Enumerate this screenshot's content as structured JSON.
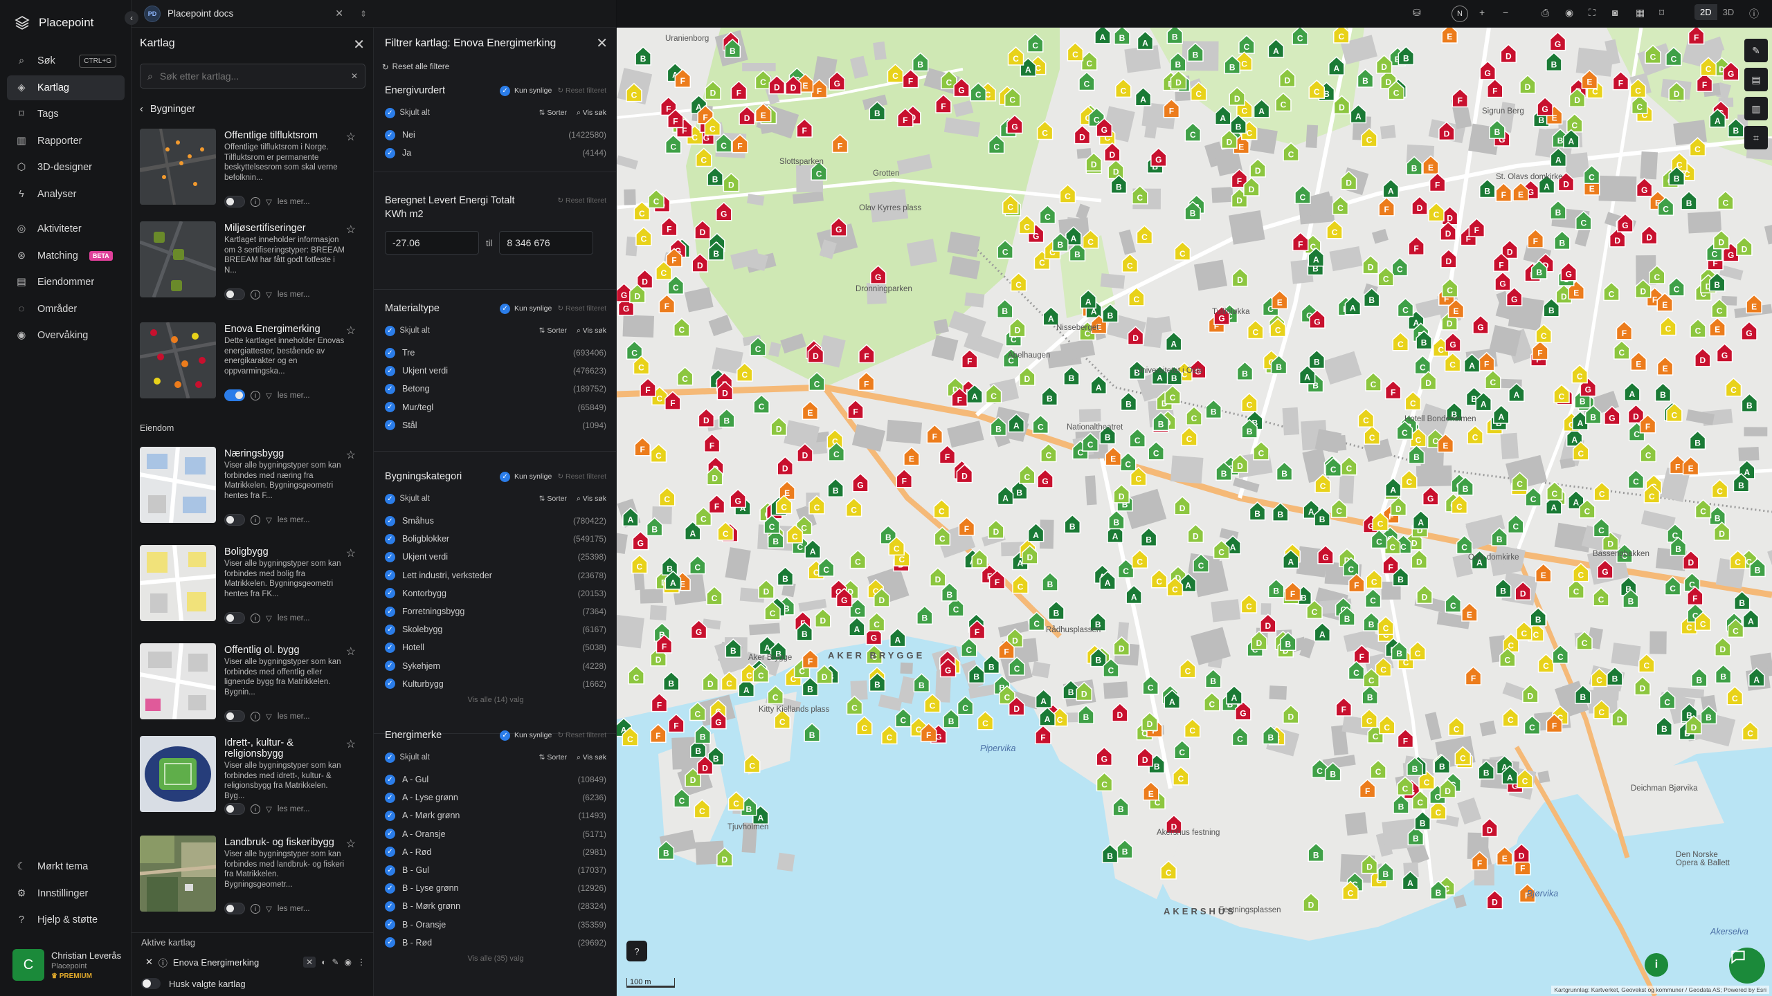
{
  "app": {
    "name": "Placepoint"
  },
  "nav": {
    "items": [
      {
        "label": "Søk",
        "icon": "search-icon",
        "shortcut": "CTRL+G"
      },
      {
        "label": "Kartlag",
        "icon": "layers-icon"
      },
      {
        "label": "Tags",
        "icon": "bookmark-icon"
      },
      {
        "label": "Rapporter",
        "icon": "chart-icon"
      },
      {
        "label": "3D-designer",
        "icon": "cube-icon"
      },
      {
        "label": "Analyser",
        "icon": "lightning-icon"
      },
      {
        "label": "Aktiviteter",
        "icon": "activity-icon"
      },
      {
        "label": "Matching",
        "icon": "matching-icon",
        "badge": "BETA"
      },
      {
        "label": "Eiendommer",
        "icon": "building-icon"
      },
      {
        "label": "Områder",
        "icon": "area-icon"
      },
      {
        "label": "Overvåking",
        "icon": "monitor-icon"
      }
    ],
    "bottom": [
      {
        "label": "Mørkt tema",
        "icon": "moon-icon"
      },
      {
        "label": "Innstillinger",
        "icon": "gear-icon"
      },
      {
        "label": "Hjelp & støtte",
        "icon": "help-icon"
      }
    ],
    "user": {
      "initial": "C",
      "name": "Christian Leverås",
      "org": "Placepoint",
      "plan": "PREMIUM"
    }
  },
  "tab": {
    "badge": "PD",
    "title": "Placepoint docs"
  },
  "layers": {
    "title": "Kartlag",
    "search_placeholder": "Søk etter kartlag...",
    "breadcrumb": "Bygninger",
    "more_label": "les mer...",
    "cards1": [
      {
        "title": "Offentlige tilfluktsrom",
        "desc": "Offentlige tilfluktsrom i Norge. Tilfluktsrom er permanente beskyttelsesrom som skal verne befolknin...",
        "on": false,
        "thumb": "dark-dots"
      },
      {
        "title": "Miljøsertifiseringer",
        "desc": "Kartlaget inneholder informasjon om 3 sertifiseringstyper: BREEAM BREEAM har fått godt fotfeste i N...",
        "on": false,
        "thumb": "dark-leaf"
      },
      {
        "title": "Enova Energimerking",
        "desc": "Dette kartlaget inneholder Enovas energiattester, bestående av energikarakter og en oppvarmingska...",
        "on": true,
        "thumb": "dark-energy"
      }
    ],
    "section2": "Eiendom",
    "cards2": [
      {
        "title": "Næringsbygg",
        "desc": "Viser alle bygningstyper som kan forbindes med næring fra Matrikkelen. Bygningsgeometri hentes fra F...",
        "on": false,
        "thumb": "light-blue"
      },
      {
        "title": "Boligbygg",
        "desc": "Viser alle bygningstyper som kan forbindes med bolig fra Matrikkelen. Bygningsgeometri hentes fra FK...",
        "on": false,
        "thumb": "light-yellow"
      },
      {
        "title": "Offentlig ol. bygg",
        "desc": "Viser alle bygningstyper som kan forbindes med offentlig eller lignende bygg fra Matrikkelen. Bygnin...",
        "on": false,
        "thumb": "light-pink"
      },
      {
        "title": "Idrett-, kultur- & religionsbygg",
        "desc": "Viser alle bygningstyper som kan forbindes med idrett-, kultur- & religionsbygg fra Matrikkelen. Byg...",
        "on": false,
        "thumb": "stadium"
      },
      {
        "title": "Landbruk- og fiskeribygg",
        "desc": "Viser alle bygningstyper som kan forbindes med landbruk- og fiskeri fra Matrikkelen. Bygningsgeometr...",
        "on": false,
        "thumb": "aerial"
      }
    ],
    "active_title": "Aktive kartlag",
    "active_layer": "Enova Energimerking",
    "remember": "Husk valgte kartlag"
  },
  "filter": {
    "title": "Filtrer kartlag: Enova Energimerking",
    "reset_all": "Reset alle filtere",
    "only_visible": "Kun synlige",
    "reset_filter": "Reset filteret",
    "hide_all": "Skjult alt",
    "sort": "Sorter",
    "show_search": "Vis søk",
    "between": "til",
    "sections": {
      "energivurdert": {
        "title": "Energivurdert",
        "rows": [
          {
            "label": "Nei",
            "count": "(1422580)"
          },
          {
            "label": "Ja",
            "count": "(4144)"
          }
        ]
      },
      "levert": {
        "title": "Beregnet Levert Energi Totalt KWh m2",
        "min": "-27.06",
        "max": "8 346 676"
      },
      "materialtype": {
        "title": "Materialtype",
        "rows": [
          {
            "label": "Tre",
            "count": "(693406)"
          },
          {
            "label": "Ukjent verdi",
            "count": "(476623)"
          },
          {
            "label": "Betong",
            "count": "(189752)"
          },
          {
            "label": "Mur/tegl",
            "count": "(65849)"
          },
          {
            "label": "Stål",
            "count": "(1094)"
          }
        ]
      },
      "bygningskategori": {
        "title": "Bygningskategori",
        "more": "Vis alle (14) valg",
        "rows": [
          {
            "label": "Småhus",
            "count": "(780422)"
          },
          {
            "label": "Boligblokker",
            "count": "(549175)"
          },
          {
            "label": "Ukjent verdi",
            "count": "(25398)"
          },
          {
            "label": "Lett industri, verksteder",
            "count": "(23678)"
          },
          {
            "label": "Kontorbygg",
            "count": "(20153)"
          },
          {
            "label": "Forretningsbygg",
            "count": "(7364)"
          },
          {
            "label": "Skolebygg",
            "count": "(6167)"
          },
          {
            "label": "Hotell",
            "count": "(5038)"
          },
          {
            "label": "Sykehjem",
            "count": "(4228)"
          },
          {
            "label": "Kulturbygg",
            "count": "(1662)"
          }
        ]
      },
      "energimerke": {
        "title": "Energimerke",
        "more": "Vis alle (35) valg",
        "rows": [
          {
            "label": "A - Gul",
            "count": "(10849)"
          },
          {
            "label": "A - Lyse grønn",
            "count": "(6236)"
          },
          {
            "label": "A - Mørk grønn",
            "count": "(11493)"
          },
          {
            "label": "A - Oransje",
            "count": "(5171)"
          },
          {
            "label": "A - Rød",
            "count": "(2981)"
          },
          {
            "label": "B - Gul",
            "count": "(17037)"
          },
          {
            "label": "B - Lyse grønn",
            "count": "(12926)"
          },
          {
            "label": "B - Mørk grønn",
            "count": "(28324)"
          },
          {
            "label": "B - Oransje",
            "count": "(35359)"
          },
          {
            "label": "B - Rød",
            "count": "(29692)"
          }
        ]
      }
    }
  },
  "topbar": {
    "north": "N",
    "mode_2d": "2D",
    "mode_3d": "3D"
  },
  "map": {
    "places": [
      "Uranienborg",
      "Slottsparken",
      "Grotten",
      "Dronningparken",
      "Nisseberget",
      "Abelhaugen",
      "Tullinløkka",
      "Universitetet i Oslo",
      "Nationaltheatret",
      "St. Olavs domkirke",
      "Hotell Bondeheimen",
      "Oslo domkirke",
      "Aker Brygge",
      "Tjuvholmen",
      "Kitty Kiellands plass",
      "Akershus festning",
      "Festningsplassen",
      "Deichman Bjørvika",
      "Den Norske Opera & Ballett",
      "Rådhusplassen",
      "Olav Kyrres plass",
      "Sigrun Berg",
      "Bassengbakken"
    ],
    "district1": "AKER BRYGGE",
    "district2": "AKERSHUS",
    "waters": [
      "Pipervika",
      "Bjørvika",
      "Akerselva"
    ],
    "scale": "100 m",
    "attribution": "Kartgrunnlag: Kartverket, Geovekst og kommuner / Geodata AS; Powered by Esri",
    "help": "?",
    "colors": {
      "dark_green": "#1a7a35",
      "light_green": "#8cc63f",
      "mid_green": "#3fa047",
      "yellow": "#e8d21a",
      "orange": "#ec7c1c",
      "red": "#c8102e",
      "water": "#b9e4f4",
      "park": "#cfe8b4",
      "building": "#c9c9c9"
    }
  }
}
